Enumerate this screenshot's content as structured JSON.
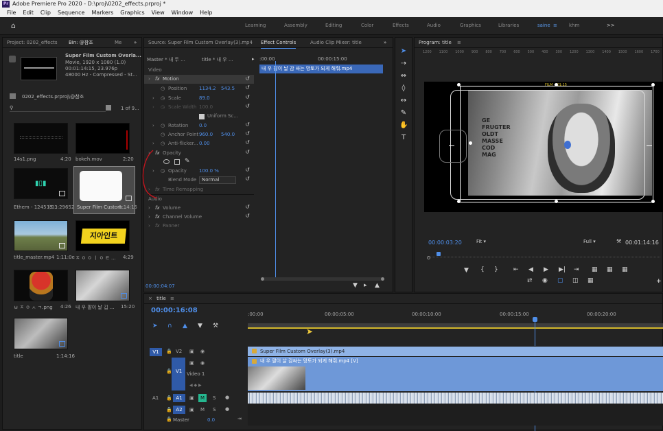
{
  "window": {
    "title": "Adobe Premiere Pro 2020 - D:\\proj\\0202_effects.prproj *",
    "logo": "Pr"
  },
  "menu": [
    "File",
    "Edit",
    "Clip",
    "Sequence",
    "Markers",
    "Graphics",
    "View",
    "Window",
    "Help"
  ],
  "workspaces": {
    "items": [
      "Learning",
      "Assembly",
      "Editing",
      "Color",
      "Effects",
      "Audio",
      "Graphics",
      "Libraries"
    ],
    "active": "saine",
    "extra": "khm",
    "more": ">>"
  },
  "project": {
    "tab_project": "Project: 0202_effects",
    "tab_bin": "Bin: @참조",
    "tab_more": "Me",
    "preview_name": "Super Film Custom Overla...",
    "preview_info1": "Movie, 1920 x 1080 (1.0)",
    "preview_info2": "00:01:14:15, 23.976p",
    "preview_info3": "48000 Hz - Compressed - St...",
    "path": "0202_effects.prproj\\@참조",
    "count": "1 of 9...",
    "items": [
      {
        "name": "14s1.png",
        "dur": "4:20"
      },
      {
        "name": "bokeh.mov",
        "dur": "2:20"
      },
      {
        "name": "Ethem - 1245 (5...",
        "dur": "3:03:29652"
      },
      {
        "name": "Super Film Custom...",
        "dur": "1:14:15"
      },
      {
        "name": "title_master.mp4",
        "dur": "1:11:0e"
      },
      {
        "name": "ㅈ ㅇ ㅇ ㅣ ㅇ ㅌ ...",
        "dur": "4:29"
      },
      {
        "name": "ㅂ ㅈ ㅇ ㅅ ㄱ.png",
        "dur": "4:26"
      },
      {
        "name": "내 우 팔이 날 깁 ...",
        "dur": "15:20"
      },
      {
        "name": "title",
        "dur": "1:14:16"
      }
    ],
    "logo_text": "지아인트"
  },
  "effect_controls": {
    "tab_source": "Source: Super Film Custom Overlay(3).mp4",
    "tab_ec": "Effect Controls",
    "tab_mixer": "Audio Clip Mixer: title",
    "master": "Master * 내 두 ...",
    "clip": "title * 내 우 ...",
    "tl_start": ":00:00",
    "tl_mark": "00:00:15:00",
    "clip_label": "내 우 팔이 날 감 싸는 망토가 되게 해줘.mp4",
    "video_label": "Video",
    "motion": "Motion",
    "position_label": "Position",
    "position_x": "1134.2",
    "position_y": "543.5",
    "scale_label": "Scale",
    "scale_val": "89.0",
    "scale_width_label": "Scale Width",
    "scale_width_val": "100.0",
    "uniform": "Uniform Sc...",
    "rotation_label": "Rotation",
    "rotation_val": "0.0",
    "anchor_label": "Anchor Point",
    "anchor_x": "960.0",
    "anchor_y": "540.0",
    "antiflicker_label": "Anti-flicker...",
    "antiflicker_val": "0.00",
    "opacity_label": "Opacity",
    "opacity_val_label": "Opacity",
    "opacity_val": "100.0 %",
    "blend_label": "Blend Mode",
    "blend_val": "Normal",
    "time_remap": "Time Remapping",
    "audio_label": "Audio",
    "volume": "Volume",
    "channel_volume": "Channel Volume",
    "panner": "Panner",
    "footer_tc": "00:00:04:07"
  },
  "program": {
    "tab": "Program: title",
    "ruler": [
      "1200",
      "1100",
      "1000",
      "900",
      "800",
      "700",
      "600",
      "500",
      "400",
      "300",
      "1200",
      "1300",
      "1400",
      "1500",
      "1600",
      "1700"
    ],
    "timecode": "00:00:03:20",
    "fit": "Fit",
    "quality": "Full",
    "duration": "00:01:14:16",
    "overlay_text": "FILM  •  01:15"
  },
  "timeline": {
    "tab": "title",
    "timecode": "00:00:16:08",
    "ruler": [
      ":00:00",
      "00:00:05:00",
      "00:00:10:00",
      "00:00:15:00",
      "00:00:20:00"
    ],
    "tracks": [
      {
        "src": "V1",
        "lock": "",
        "name": "V2"
      },
      {
        "src": "",
        "lock": "",
        "name": "V1",
        "label": "Video 1"
      },
      {
        "src": "A1",
        "name": "A1",
        "m": "M",
        "s": "S"
      },
      {
        "src": "",
        "name": "A2",
        "m": "M",
        "s": "S"
      }
    ],
    "master": "Master",
    "master_val": "0.0",
    "clip_v2": "Super Film Custom Overlay(3).mp4",
    "clip_v1": "내 우 팔이 날 감싸는 망토가 되게 해줘.mp4 [V]"
  }
}
